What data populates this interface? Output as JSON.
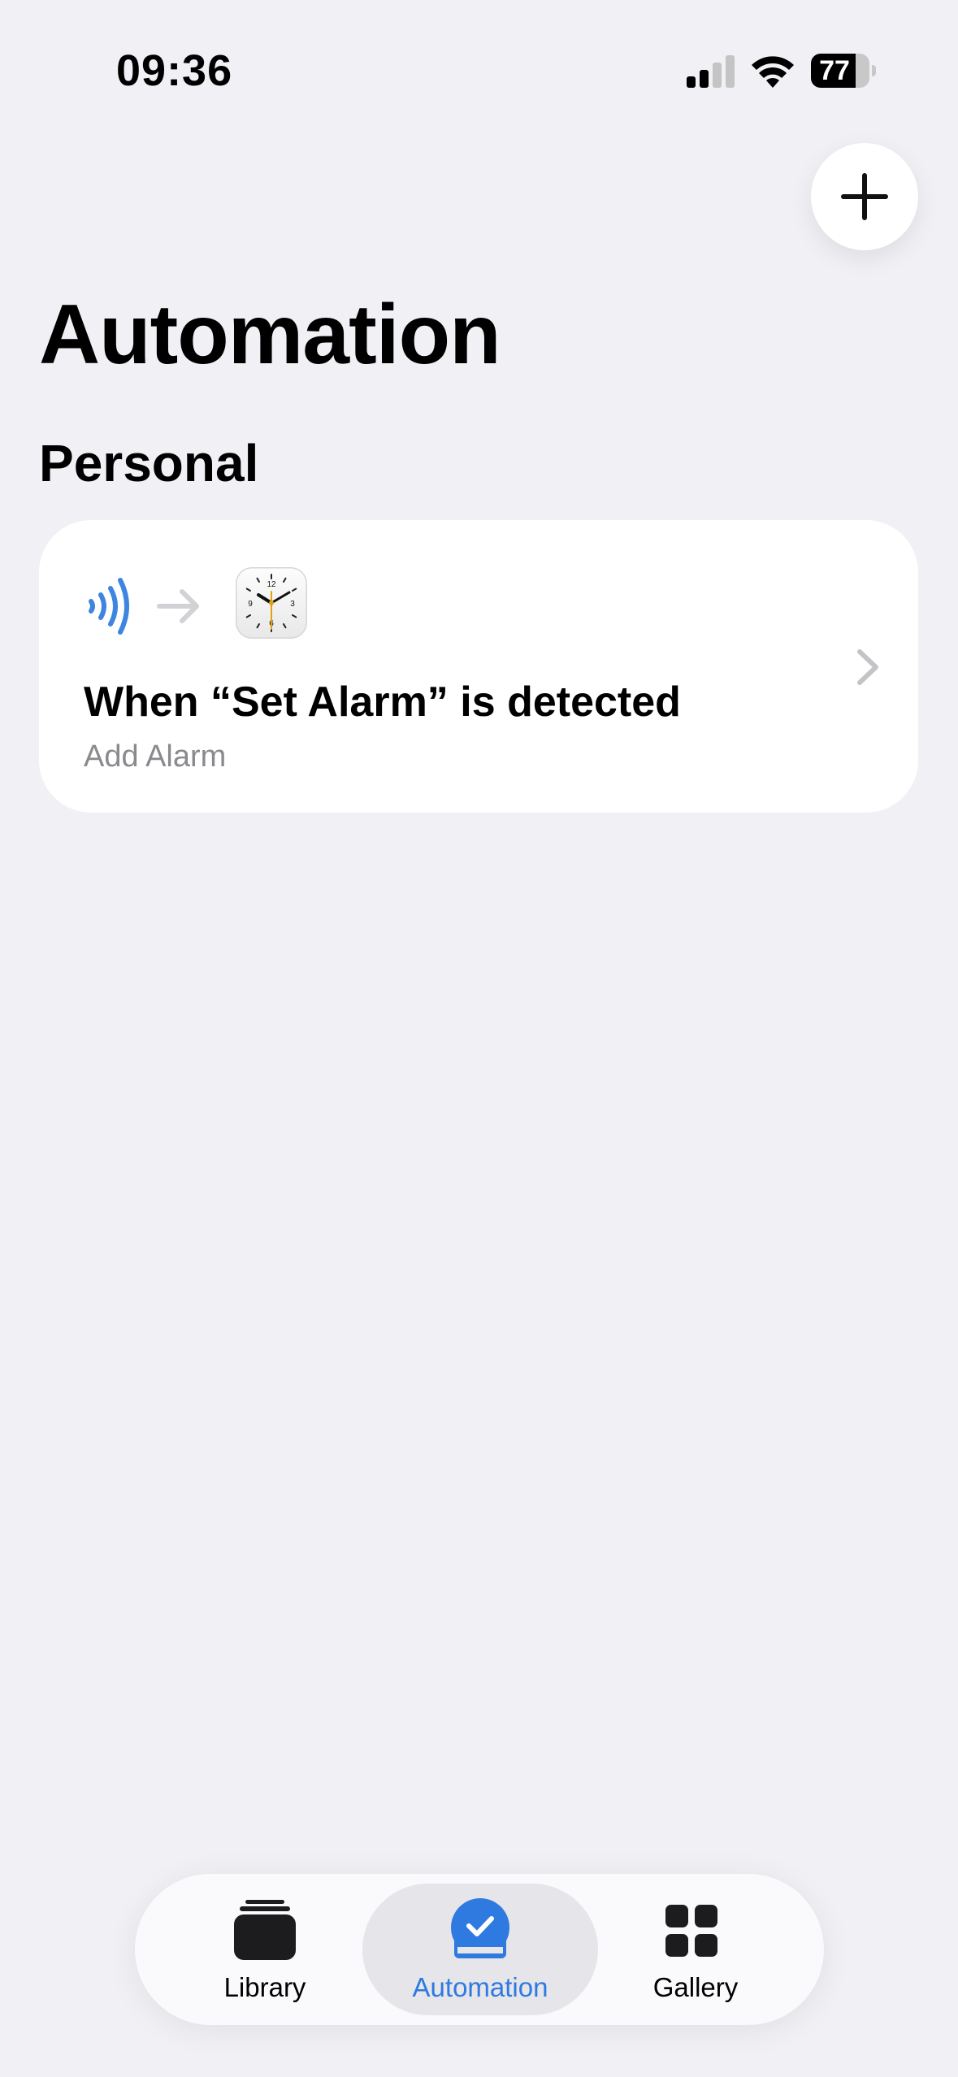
{
  "status_bar": {
    "time": "09:36",
    "battery_level": 77,
    "signal_bars_active": 2,
    "signal_bars_total": 4
  },
  "header": {
    "title": "Automation",
    "add_button_icon": "plus-icon"
  },
  "section": {
    "title": "Personal"
  },
  "automations": [
    {
      "trigger_icon": "nfc-icon",
      "action_app_icon": "clock-app-icon",
      "title": "When “Set Alarm” is detected",
      "subtitle": "Add Alarm"
    }
  ],
  "tab_bar": {
    "tabs": [
      {
        "label": "Library",
        "icon": "library-stack-icon",
        "selected": false
      },
      {
        "label": "Automation",
        "icon": "automation-check-icon",
        "selected": true
      },
      {
        "label": "Gallery",
        "icon": "gallery-grid-icon",
        "selected": false
      }
    ]
  },
  "colors": {
    "background": "#f0f0f5",
    "accent": "#2e7ae0",
    "secondary_text": "#8a8a8e",
    "card": "#ffffff"
  }
}
